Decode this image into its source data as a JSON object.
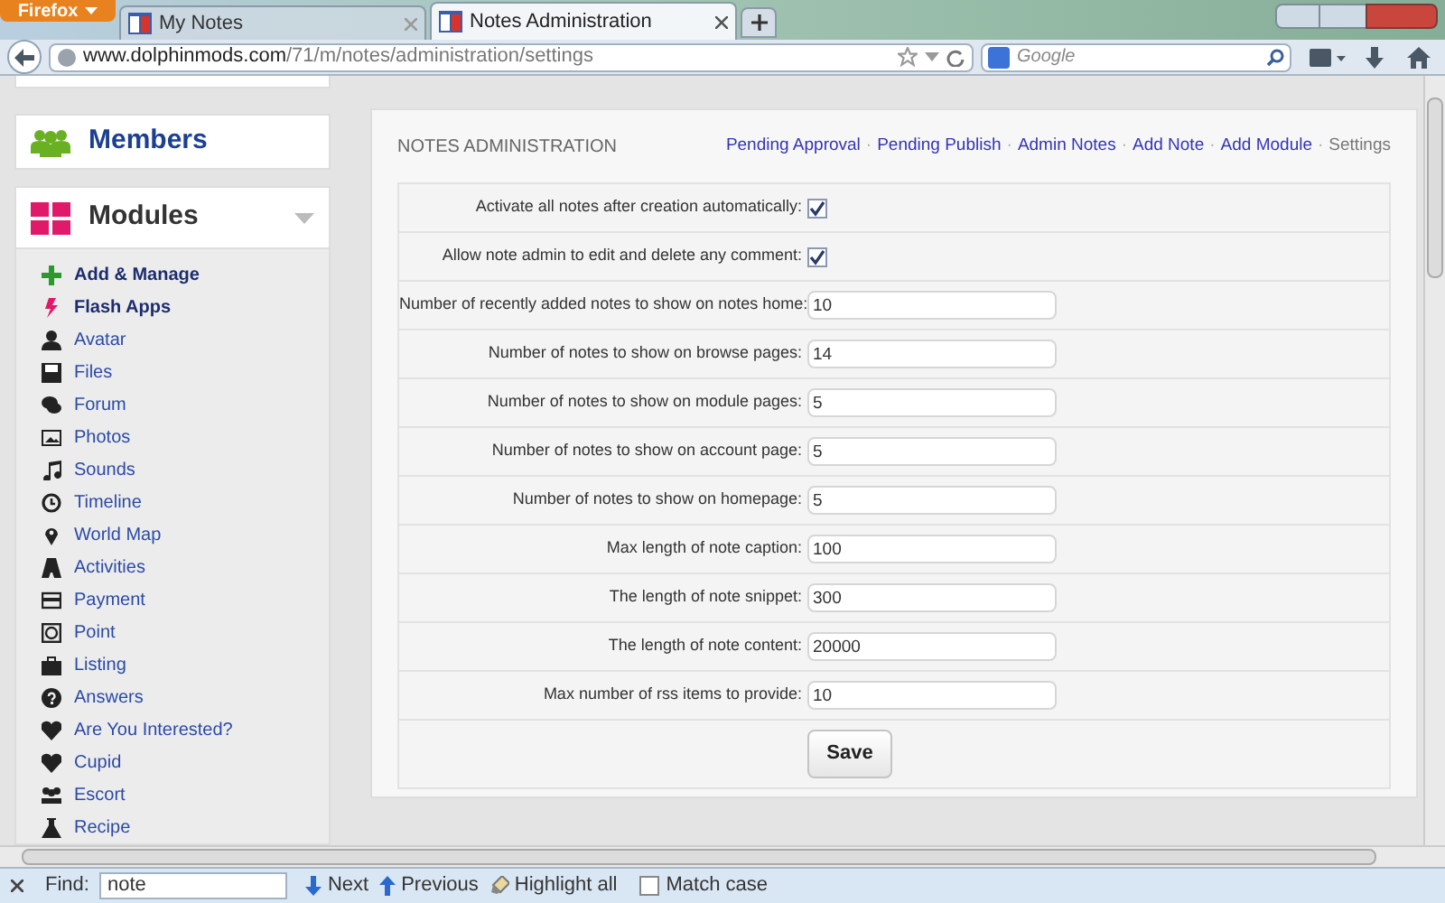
{
  "browser": {
    "menu_button": "Firefox",
    "tabs": [
      {
        "title": "My Notes",
        "selected": false
      },
      {
        "title": "Notes Administration",
        "selected": true
      }
    ],
    "url_domain": "www.dolphinmods.com",
    "url_path": "/71/m/notes/administration/settings",
    "search_placeholder": "Google"
  },
  "sidebar": {
    "members": "Members",
    "modules": {
      "title": "Modules",
      "expanded": true
    },
    "items": [
      {
        "label": "Add & Manage",
        "kind": "action"
      },
      {
        "label": "Flash Apps",
        "kind": "action"
      },
      {
        "label": "Avatar",
        "kind": "module"
      },
      {
        "label": "Files",
        "kind": "module"
      },
      {
        "label": "Forum",
        "kind": "module"
      },
      {
        "label": "Photos",
        "kind": "module"
      },
      {
        "label": "Sounds",
        "kind": "module"
      },
      {
        "label": "Timeline",
        "kind": "module"
      },
      {
        "label": "World Map",
        "kind": "module"
      },
      {
        "label": "Activities",
        "kind": "module"
      },
      {
        "label": "Payment",
        "kind": "module"
      },
      {
        "label": "Point",
        "kind": "module"
      },
      {
        "label": "Listing",
        "kind": "module"
      },
      {
        "label": "Answers",
        "kind": "module"
      },
      {
        "label": "Are You Interested?",
        "kind": "module"
      },
      {
        "label": "Cupid",
        "kind": "module"
      },
      {
        "label": "Escort",
        "kind": "module"
      },
      {
        "label": "Recipe",
        "kind": "module"
      }
    ]
  },
  "panel": {
    "title": "NOTES ADMINISTRATION",
    "link_separator": "·",
    "links": [
      {
        "label": "Pending Approval",
        "selected": false
      },
      {
        "label": "Pending Publish",
        "selected": false
      },
      {
        "label": "Admin Notes",
        "selected": false
      },
      {
        "label": "Add Note",
        "selected": false
      },
      {
        "label": "Add Module",
        "selected": false
      },
      {
        "label": "Settings",
        "selected": true
      }
    ],
    "settings": [
      {
        "label": "Activate all notes after creation automatically:",
        "kind": "checkbox",
        "checked": true
      },
      {
        "label": "Allow note admin to edit and delete any comment:",
        "kind": "checkbox",
        "checked": true
      },
      {
        "label": "Number of recently added notes to show on notes home:",
        "kind": "text",
        "value": "10"
      },
      {
        "label": "Number of notes to show on browse pages:",
        "kind": "text",
        "value": "14"
      },
      {
        "label": "Number of notes to show on module pages:",
        "kind": "text",
        "value": "5"
      },
      {
        "label": "Number of notes to show on account page:",
        "kind": "text",
        "value": "5"
      },
      {
        "label": "Number of notes to show on homepage:",
        "kind": "text",
        "value": "5"
      },
      {
        "label": "Max length of note caption:",
        "kind": "text",
        "value": "100"
      },
      {
        "label": "The length of note snippet:",
        "kind": "text",
        "value": "300"
      },
      {
        "label": "The length of note content:",
        "kind": "text",
        "value": "20000"
      },
      {
        "label": "Max number of rss items to provide:",
        "kind": "text",
        "value": "10"
      }
    ],
    "save_button": "Save"
  },
  "find_bar": {
    "label": "Find:",
    "value": "note",
    "next": "Next",
    "previous": "Previous",
    "highlight_all": "Highlight all",
    "match_case": {
      "label": "Match case",
      "checked": false
    }
  }
}
